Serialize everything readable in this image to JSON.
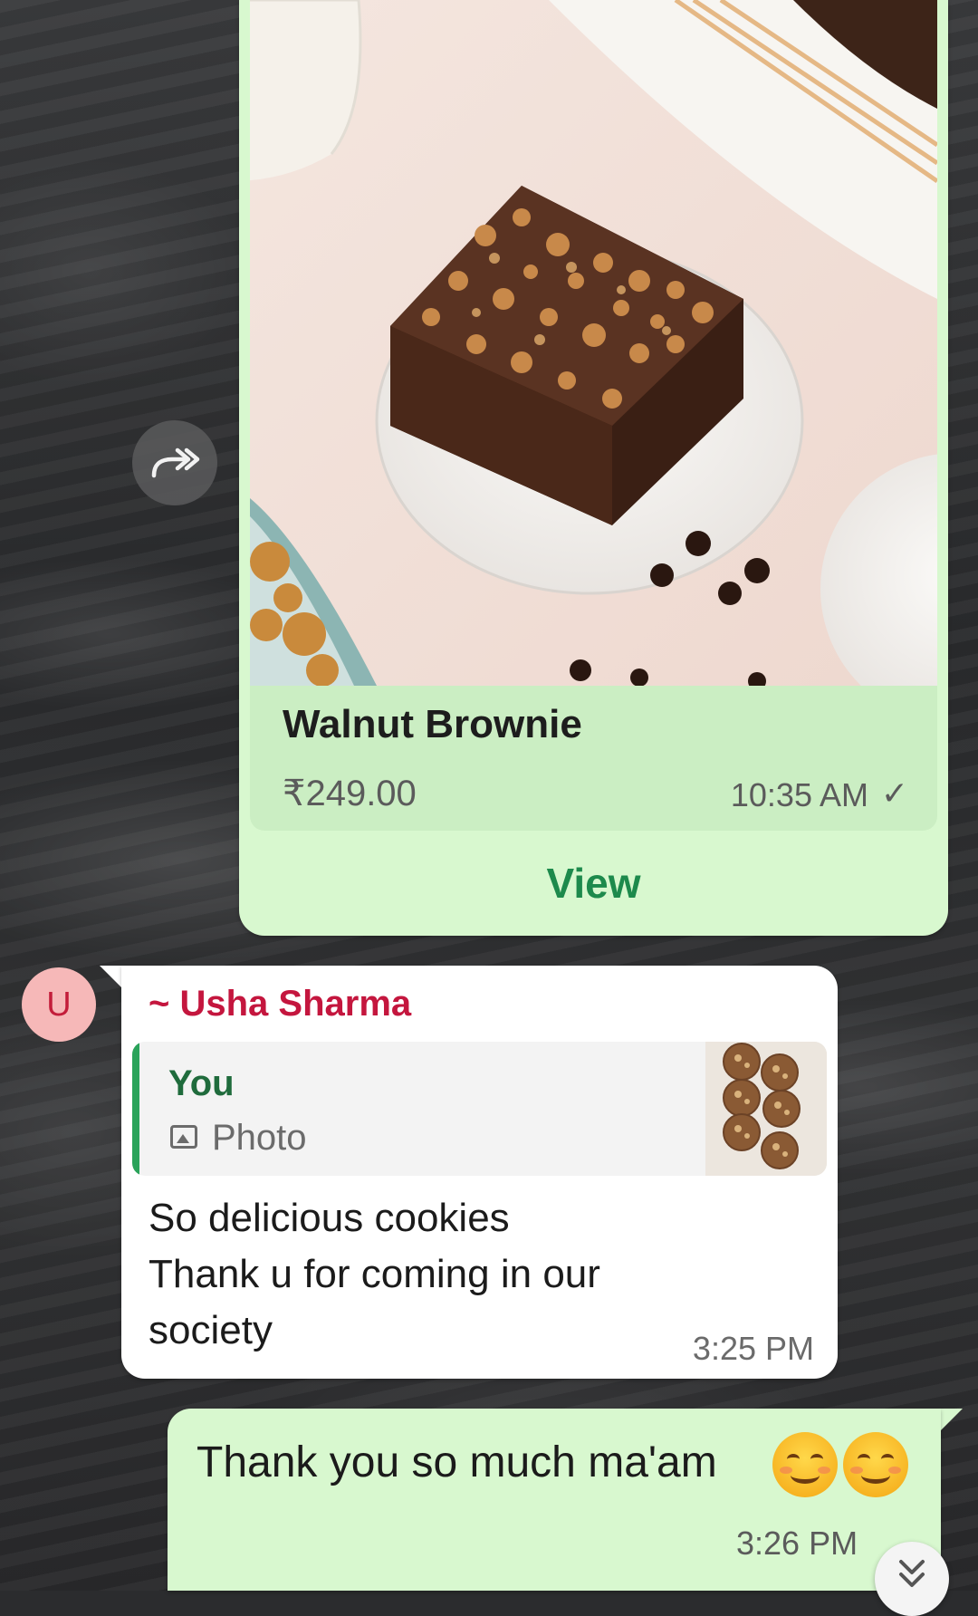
{
  "product_message": {
    "name": "Walnut Brownie",
    "price": "₹249.00",
    "time": "10:35 AM",
    "status_tick": "✓",
    "view_label": "View",
    "forward_icon": "forward-icon"
  },
  "incoming_message": {
    "avatar_initial": "U",
    "sender": "~ Usha Sharma",
    "quote_author": "You",
    "quote_type": "Photo",
    "text_lines": [
      "So delicious cookies",
      "Thank u for coming in our",
      "society"
    ],
    "time": "3:25 PM"
  },
  "outgoing_message": {
    "text": "Thank you so much ma'am",
    "emojis": [
      "smiling-face-emoji",
      "smiling-face-emoji"
    ],
    "time": "3:26 PM"
  },
  "scroll_down_icon": "double-chevron-down-icon",
  "colors": {
    "outgoing_bubble": "#d8f8cf",
    "incoming_bubble": "#ffffff",
    "sender_name": "#c4163e",
    "quote_author": "#1f6b3c",
    "view_button": "#1d8a4c"
  }
}
